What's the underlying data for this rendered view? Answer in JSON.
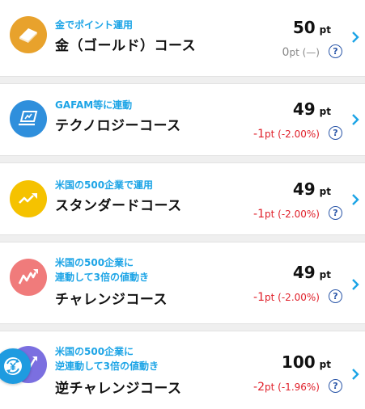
{
  "courses": [
    {
      "subtitle_lines": [
        "金でポイント運用"
      ],
      "title": "金（ゴールド）コース",
      "points": "50",
      "unit": "pt",
      "change_value": "0",
      "change_unit": "pt",
      "change_pct": "(—)",
      "change_color": "#888888",
      "icon": "gold-bar-icon",
      "icon_bg": "#e8a22c"
    },
    {
      "subtitle_lines": [
        "GAFAM等に連動"
      ],
      "title": "テクノロジーコース",
      "points": "49",
      "unit": "pt",
      "change_value": "-1",
      "change_unit": "pt",
      "change_pct": "(-2.00%)",
      "change_color": "#e0202a",
      "icon": "laptop-icon",
      "icon_bg": "#2f8fdc"
    },
    {
      "subtitle_lines": [
        "米国の500企業で運用"
      ],
      "title": "スタンダードコース",
      "points": "49",
      "unit": "pt",
      "change_value": "-1",
      "change_unit": "pt",
      "change_pct": "(-2.00%)",
      "change_color": "#e0202a",
      "icon": "trend-up-icon",
      "icon_bg": "#f5c200"
    },
    {
      "subtitle_lines": [
        "米国の500企業に",
        "連動して3倍の値動き"
      ],
      "title": "チャレンジコース",
      "points": "49",
      "unit": "pt",
      "change_value": "-1",
      "change_unit": "pt",
      "change_pct": "(-2.00%)",
      "change_color": "#e0202a",
      "icon": "zigzag-up-icon",
      "icon_bg": "#f07b7b"
    },
    {
      "subtitle_lines": [
        "米国の500企業に",
        "逆連動して3倍の値動き"
      ],
      "title": "逆チャレンジコース",
      "points": "100",
      "unit": "pt",
      "change_value": "-2",
      "change_unit": "pt",
      "change_pct": "(-1.96%)",
      "change_color": "#e0202a",
      "icon": "reverse-trend-icon",
      "icon_bg": "#7b6fe0"
    }
  ],
  "help_glyph": "?",
  "float_button": {
    "icon": "yen-exchange-icon",
    "color": "#1e9be0"
  }
}
